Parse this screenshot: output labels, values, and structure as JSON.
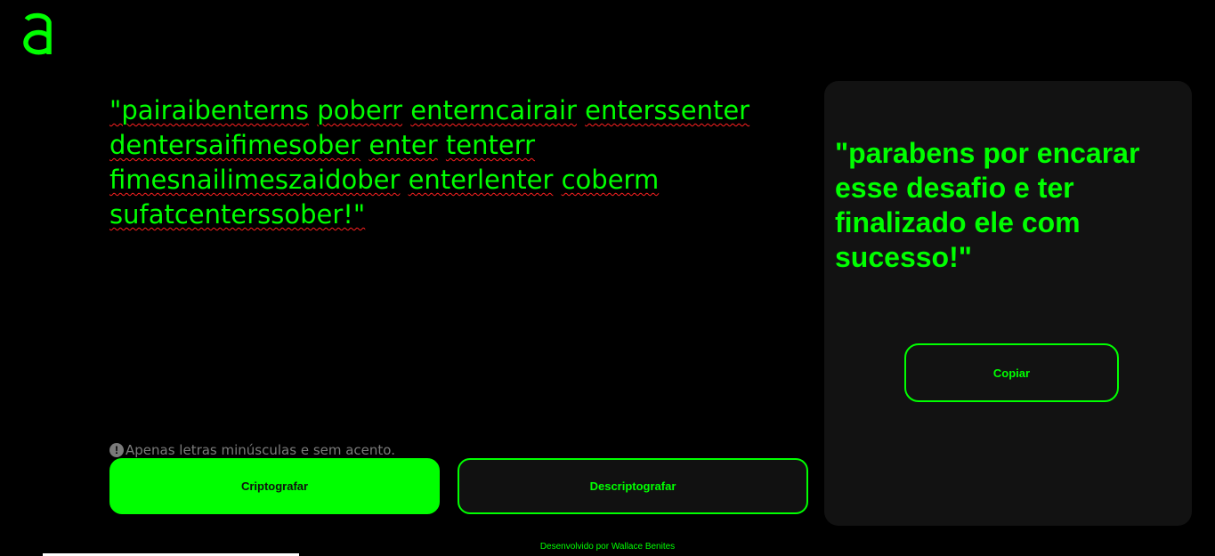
{
  "logo": {
    "icon": "alura-logo-icon",
    "color": "#00ff00"
  },
  "input": {
    "words": [
      "\"pairaibenterns",
      "poberr",
      "enterncairair",
      "enterssenter",
      "dentersaifimesober",
      "enter",
      "tenterr",
      "fimesnailimeszaidober",
      "enterlenter",
      "coberm",
      "sufatcenterssober!\""
    ],
    "hint_icon": "exclamation-circle-icon",
    "hint_text": "Apenas letras minúsculas e sem acento."
  },
  "buttons": {
    "encrypt_label": "Criptografar",
    "decrypt_label": "Descriptografar"
  },
  "output": {
    "text": "\"parabens por encarar esse desafio e ter finalizado ele com sucesso!\"",
    "copy_label": "Copiar"
  },
  "footer": {
    "text": "Desenvolvido por Wallace Benites"
  },
  "colors": {
    "accent": "#00ff00",
    "background": "#000000",
    "panel": "#121212",
    "hint": "#7a7a7a",
    "spellcheck": "#ff2020"
  }
}
